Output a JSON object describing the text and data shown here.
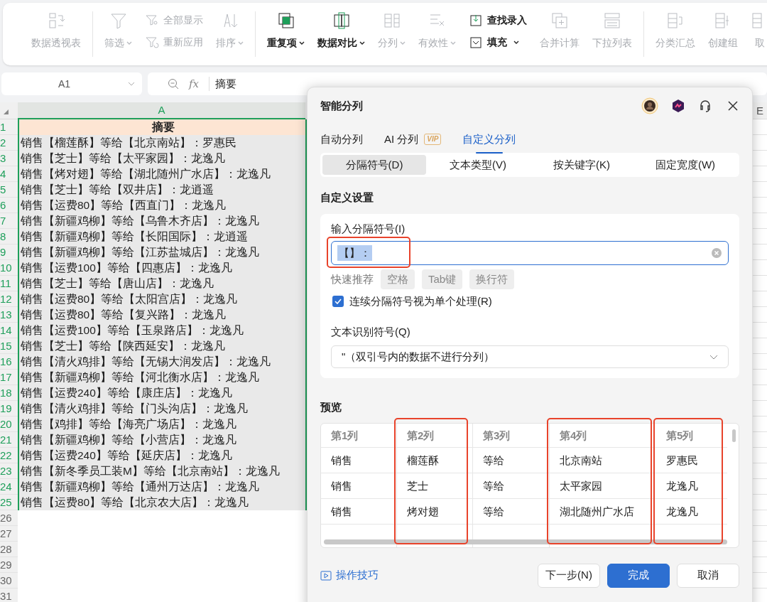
{
  "toolbar": {
    "groups": [
      [
        {
          "kind": "large",
          "label": "数据透视表",
          "disabled": true,
          "dropdown": false
        }
      ],
      [
        {
          "kind": "large",
          "label": "筛选",
          "disabled": true,
          "dropdown": true
        },
        {
          "kind": "stack",
          "items": [
            {
              "label": "全部显示",
              "disabled": true,
              "dropdown": false
            },
            {
              "label": "重新应用",
              "disabled": true,
              "dropdown": false
            }
          ]
        },
        {
          "kind": "large",
          "label": "排序",
          "disabled": true,
          "dropdown": true
        }
      ],
      [
        {
          "kind": "large",
          "label": "重复项",
          "disabled": false,
          "dropdown": true
        },
        {
          "kind": "large",
          "label": "数据对比",
          "disabled": false,
          "dropdown": true
        },
        {
          "kind": "large",
          "label": "分列",
          "disabled": true,
          "dropdown": true
        },
        {
          "kind": "large",
          "label": "有效性",
          "disabled": true,
          "dropdown": true
        },
        {
          "kind": "stack",
          "items": [
            {
              "label": "查找录入",
              "disabled": false,
              "dropdown": false
            },
            {
              "label": "填充",
              "disabled": false,
              "dropdown": true
            }
          ]
        },
        {
          "kind": "large",
          "label": "合并计算",
          "disabled": true,
          "dropdown": false
        },
        {
          "kind": "large",
          "label": "下拉列表",
          "disabled": true,
          "dropdown": false
        }
      ],
      [
        {
          "kind": "large",
          "label": "分类汇总",
          "disabled": true,
          "dropdown": false
        },
        {
          "kind": "large",
          "label": "创建组",
          "disabled": true,
          "dropdown": false
        },
        {
          "kind": "large",
          "label": "取",
          "disabled": true,
          "dropdown": false
        }
      ]
    ]
  },
  "formula_bar": {
    "cell_ref": "A1",
    "function_label": "fx",
    "formula": "摘要"
  },
  "sheet": {
    "columns": [
      {
        "label": "A",
        "selected": true
      },
      {
        "label": "E",
        "selected": false
      }
    ],
    "rows": [
      {
        "number": "1",
        "kind": "header",
        "selected": true,
        "cell": "摘要"
      },
      {
        "number": "2",
        "kind": "data",
        "selected": true,
        "cell": "销售【榴莲酥】等给【北京南站】：罗惠民"
      },
      {
        "number": "3",
        "kind": "data",
        "selected": true,
        "cell": "销售【芝士】等给【太平家园】：龙逸凡"
      },
      {
        "number": "4",
        "kind": "data",
        "selected": true,
        "cell": "销售【烤对翅】等给【湖北随州广水店】：龙逸凡"
      },
      {
        "number": "5",
        "kind": "data",
        "selected": true,
        "cell": "销售【芝士】等给【双井店】：龙逍遥"
      },
      {
        "number": "6",
        "kind": "data",
        "selected": true,
        "cell": "销售【运费80】等给【西直门】：龙逸凡"
      },
      {
        "number": "7",
        "kind": "data",
        "selected": true,
        "cell": "销售【新疆鸡柳】等给【乌鲁木齐店】：龙逸凡"
      },
      {
        "number": "8",
        "kind": "data",
        "selected": true,
        "cell": "销售【新疆鸡柳】等给【长阳国际】：龙逍遥"
      },
      {
        "number": "9",
        "kind": "data",
        "selected": true,
        "cell": "销售【新疆鸡柳】等给【江苏盐城店】：龙逸凡"
      },
      {
        "number": "10",
        "kind": "data",
        "selected": true,
        "cell": "销售【运费100】等给【四惠店】：龙逸凡"
      },
      {
        "number": "11",
        "kind": "data",
        "selected": true,
        "cell": "销售【芝士】等给【唐山店】：龙逸凡"
      },
      {
        "number": "12",
        "kind": "data",
        "selected": true,
        "cell": "销售【运费80】等给【太阳宫店】：龙逸凡"
      },
      {
        "number": "13",
        "kind": "data",
        "selected": true,
        "cell": "销售【运费80】等给【复兴路】：龙逸凡"
      },
      {
        "number": "14",
        "kind": "data",
        "selected": true,
        "cell": "销售【运费100】等给【玉泉路店】：龙逸凡"
      },
      {
        "number": "15",
        "kind": "data",
        "selected": true,
        "cell": "销售【芝士】等给【陕西延安】：龙逸凡"
      },
      {
        "number": "16",
        "kind": "data",
        "selected": true,
        "cell": "销售【清火鸡排】等给【无锡大润发店】：龙逸凡"
      },
      {
        "number": "17",
        "kind": "data",
        "selected": true,
        "cell": "销售【新疆鸡柳】等给【河北衡水店】：龙逸凡"
      },
      {
        "number": "18",
        "kind": "data",
        "selected": true,
        "cell": "销售【运费240】等给【康庄店】：龙逸凡"
      },
      {
        "number": "19",
        "kind": "data",
        "selected": true,
        "cell": "销售【清火鸡排】等给【门头沟店】：龙逸凡"
      },
      {
        "number": "20",
        "kind": "data",
        "selected": true,
        "cell": "销售【鸡排】等给【海亮广场店】：龙逸凡"
      },
      {
        "number": "21",
        "kind": "data",
        "selected": true,
        "cell": "销售【新疆鸡柳】等给【小营店】：龙逸凡"
      },
      {
        "number": "22",
        "kind": "data",
        "selected": true,
        "cell": "销售【运费240】等给【延庆店】：龙逸凡"
      },
      {
        "number": "23",
        "kind": "data",
        "selected": true,
        "cell": "销售【新冬季员工装M】等给【北京南站】：龙逸凡"
      },
      {
        "number": "24",
        "kind": "data",
        "selected": true,
        "cell": "销售【新疆鸡柳】等给【通州万达店】：龙逸凡"
      },
      {
        "number": "25",
        "kind": "data",
        "selected": true,
        "cell": "销售【运费80】等给【北京农大店】：龙逸凡"
      },
      {
        "number": "26",
        "kind": "data",
        "selected": false
      },
      {
        "number": "27",
        "kind": "data",
        "selected": false
      },
      {
        "number": "28",
        "kind": "data",
        "selected": false
      },
      {
        "number": "29",
        "kind": "data",
        "selected": false
      },
      {
        "number": "30",
        "kind": "data",
        "selected": false
      },
      {
        "number": "31",
        "kind": "data",
        "selected": false
      }
    ]
  },
  "dialog": {
    "title": "智能分列",
    "tabs": [
      {
        "label": "自动分列",
        "selected": false
      },
      {
        "label": "AI 分列",
        "badge": "VIP",
        "selected": false
      },
      {
        "label": "自定义分列",
        "selected": true
      }
    ],
    "modes": [
      {
        "label": "分隔符号(D)",
        "selected": true
      },
      {
        "label": "文本类型(V)",
        "selected": false
      },
      {
        "label": "按关键字(K)",
        "selected": false
      },
      {
        "label": "固定宽度(W)",
        "selected": false
      }
    ],
    "section_title": "自定义设置",
    "delimiter": {
      "label": "输入分隔符号(I)",
      "value": "【】：",
      "highlighted": true
    },
    "quick": {
      "label": "快速推荐",
      "chips": [
        "空格",
        "Tab键",
        "换行符"
      ]
    },
    "merge_checkbox": {
      "label": "连续分隔符号视为单个处理(R)",
      "checked": true
    },
    "qualifier": {
      "label": "文本识别符号(Q)",
      "value": "\"（双引号内的数据不进行分列）"
    },
    "preview": {
      "title": "预览",
      "columns": [
        {
          "header": "第1列",
          "highlighted": false,
          "cells": [
            "销售",
            "销售",
            "销售"
          ]
        },
        {
          "header": "第2列",
          "highlighted": true,
          "cells": [
            "榴莲酥",
            "芝士",
            "烤对翅"
          ]
        },
        {
          "header": "第3列",
          "highlighted": false,
          "cells": [
            "等给",
            "等给",
            "等给"
          ]
        },
        {
          "header": "第4列",
          "highlighted": true,
          "cells": [
            "北京南站",
            "太平家园",
            "湖北随州广水店"
          ]
        },
        {
          "header": "第5列",
          "highlighted": true,
          "cells": [
            "罗惠民",
            "龙逸凡",
            "龙逸凡"
          ]
        }
      ]
    },
    "tips_link": "操作技巧",
    "buttons": [
      {
        "label": "下一步(N)",
        "kind": "secondary"
      },
      {
        "label": "完成",
        "kind": "primary"
      },
      {
        "label": "取消",
        "kind": "secondary"
      }
    ]
  }
}
